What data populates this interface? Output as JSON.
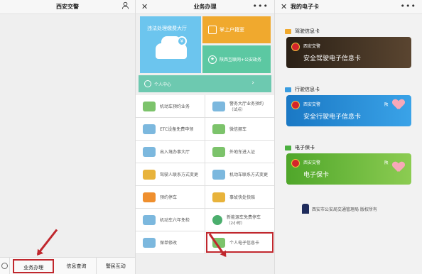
{
  "screen1": {
    "title": "西安交警",
    "nav": [
      "业务办理",
      "信息查询",
      "警民互动"
    ]
  },
  "screen2": {
    "title": "业务办理",
    "tile_blue": "违法处理缴费大厅",
    "tile_blue_coin": "¥",
    "tile_orange": "掌上户籍室",
    "tile_green": "陕西互联网+公安政务",
    "user_center": "个人中心",
    "rows": [
      [
        "机动车预约业务",
        "警务大厅业务预约",
        "（试点）"
      ],
      [
        "ETC设备免费申领",
        "微信挪车",
        ""
      ],
      [
        "出入境办事大厅",
        "外地车进入证",
        ""
      ],
      [
        "驾驶人联系方式变更",
        "机动车联系方式变更",
        ""
      ],
      [
        "预约停车",
        "事故快处快赔",
        ""
      ],
      [
        "机动车六年免检",
        "新能源车免费停车",
        "（2小时）"
      ],
      [
        "保单修改",
        "个人电子信息卡",
        ""
      ]
    ]
  },
  "screen3": {
    "title": "我的电子卡",
    "sections": [
      {
        "label": "驾驶信息卡",
        "org": "西安交警",
        "card": "安全驾驶电子信息卡",
        "tag": ""
      },
      {
        "label": "行驶信息卡",
        "org": "西安交警",
        "card": "安全行驶电子信息卡",
        "tag": "陕"
      },
      {
        "label": "电子保卡",
        "org": "西安交警",
        "card": "电子保卡",
        "tag": "陕"
      }
    ],
    "footer": "西安市公安局交通管理局 版权所有"
  },
  "colors": {
    "accent_red": "#c0272d",
    "tile_blue": "#6cc5ee",
    "tile_orange": "#f0a92e",
    "tile_green": "#5cc8a2",
    "card_dark": "#3a2c1f",
    "card_blue": "#1f86d1",
    "card_green": "#66b836"
  }
}
